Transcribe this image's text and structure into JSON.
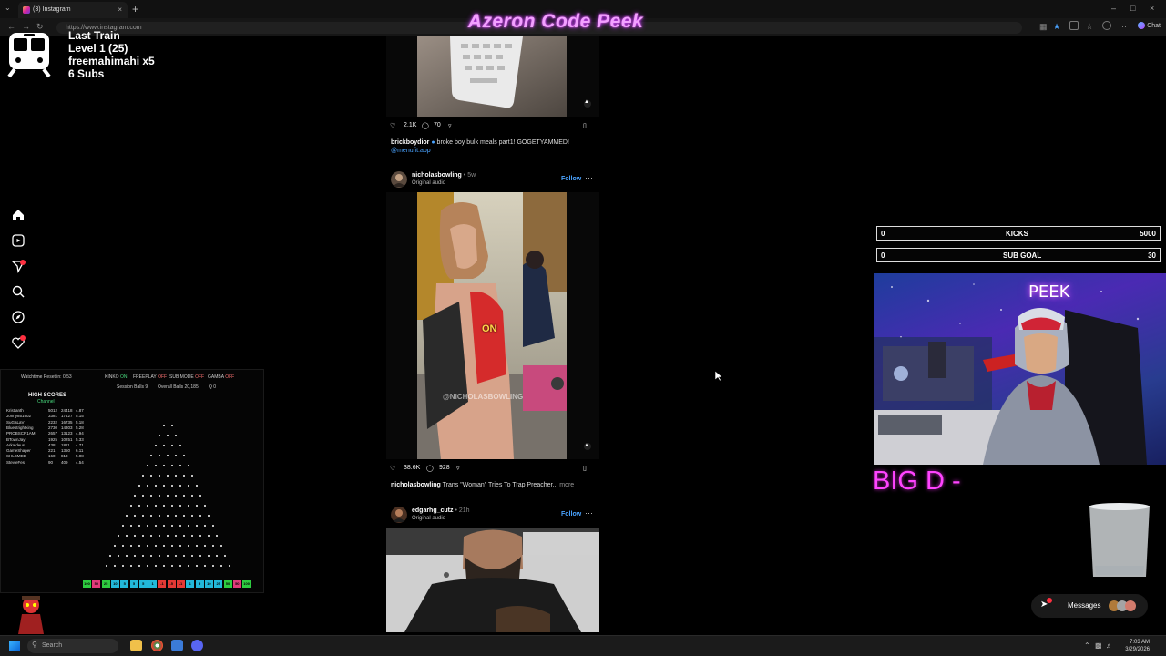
{
  "browser": {
    "tab_title": "(3) Instagram",
    "url": "https://www.instagram.com",
    "chat_label": "Chat"
  },
  "overlay_title": "Azeron Code Peek",
  "train_widget": {
    "line1": "Last Train",
    "line2": "Level 1  (25)",
    "line3": "freemahimahi x5",
    "line4": "6 Subs"
  },
  "rail": {
    "icons": [
      "home-icon",
      "reels-icon",
      "direct-icon",
      "search-icon",
      "explore-icon",
      "notifications-icon"
    ]
  },
  "posts": [
    {
      "likes": "2.1K",
      "comments": "70",
      "caption_user": "brickboydior",
      "caption_text": "broke boy bulk meals part1! GOGETYAMMED!",
      "caption_link": "@menufit.app"
    },
    {
      "user": "nicholasbowling",
      "time": "5w",
      "audio": "Original audio",
      "follow": "Follow",
      "video_caption": "ON",
      "watermark": "@NICHOLASBOWLING",
      "likes": "38.6K",
      "comments": "928",
      "caption_user": "nicholasbowling",
      "caption_text": "Trans \"Woman\" Tries To Trap Preacher...",
      "caption_more": "more"
    },
    {
      "user": "edgarhg_cutz",
      "time": "21h",
      "audio": "Original audio",
      "follow": "Follow"
    }
  ],
  "plinko": {
    "watchtime": "Watchtime Reset in: 0:53",
    "kinko": "KINKO",
    "kinko_state": "ON",
    "freeplay": "FREEPLAY",
    "freeplay_state": "OFF",
    "submode": "SUB MODE",
    "submode_state": "OFF",
    "gamba": "GAMBA",
    "gamba_state": "OFF",
    "session_balls": "Session Balls  9",
    "overall_balls": "Overall Balls  20,185",
    "q": "Q  0",
    "high_scores_title": "HIGH SCORES",
    "high_scores_sub": "Channel",
    "high_scores": [
      [
        "Kristianth",
        "5012",
        "24418",
        "4.87"
      ],
      [
        "Jonny851902",
        "3381",
        "17427",
        "5.15"
      ],
      [
        "SuGaLaV",
        "2232",
        "16735",
        "5.18"
      ],
      [
        "Bluestrightking",
        "2730",
        "14303",
        "5.28"
      ],
      [
        "PROBSCR1AM",
        "2657",
        "13123",
        "4.94"
      ],
      [
        "BTownJay",
        "1925",
        "10251",
        "5.33"
      ],
      [
        "Arkaideus",
        "438",
        "1811",
        "4.71"
      ],
      [
        "GameShaper",
        "221",
        "1350",
        "6.11"
      ],
      [
        "SHLBMEE",
        "160",
        "813",
        "5.08"
      ],
      [
        "StevieFes",
        "90",
        "409",
        "4.54"
      ]
    ],
    "slots": [
      "100",
      "50",
      "25",
      "10",
      "5",
      "5",
      "5",
      "1",
      "-1",
      "-5",
      "-1",
      "1",
      "5",
      "10",
      "25",
      "50",
      "50",
      "100"
    ]
  },
  "goals": {
    "kicks": {
      "current": "0",
      "label": "KICKS",
      "target": "5000"
    },
    "subs": {
      "current": "0",
      "label": "SUB GOAL",
      "target": "30"
    }
  },
  "cam": {
    "neon": "PEEK"
  },
  "big_d": "BIG D -",
  "messages_label": "Messages",
  "taskbar": {
    "search": "Search",
    "time": "7:03 AM",
    "date": "3/29/2026"
  },
  "colors": {
    "follow_blue": "#4aa3ff",
    "overlay_pink": "#f2a0ff",
    "big_d_magenta": "#ff44ff",
    "badge_red": "#ff3040"
  }
}
